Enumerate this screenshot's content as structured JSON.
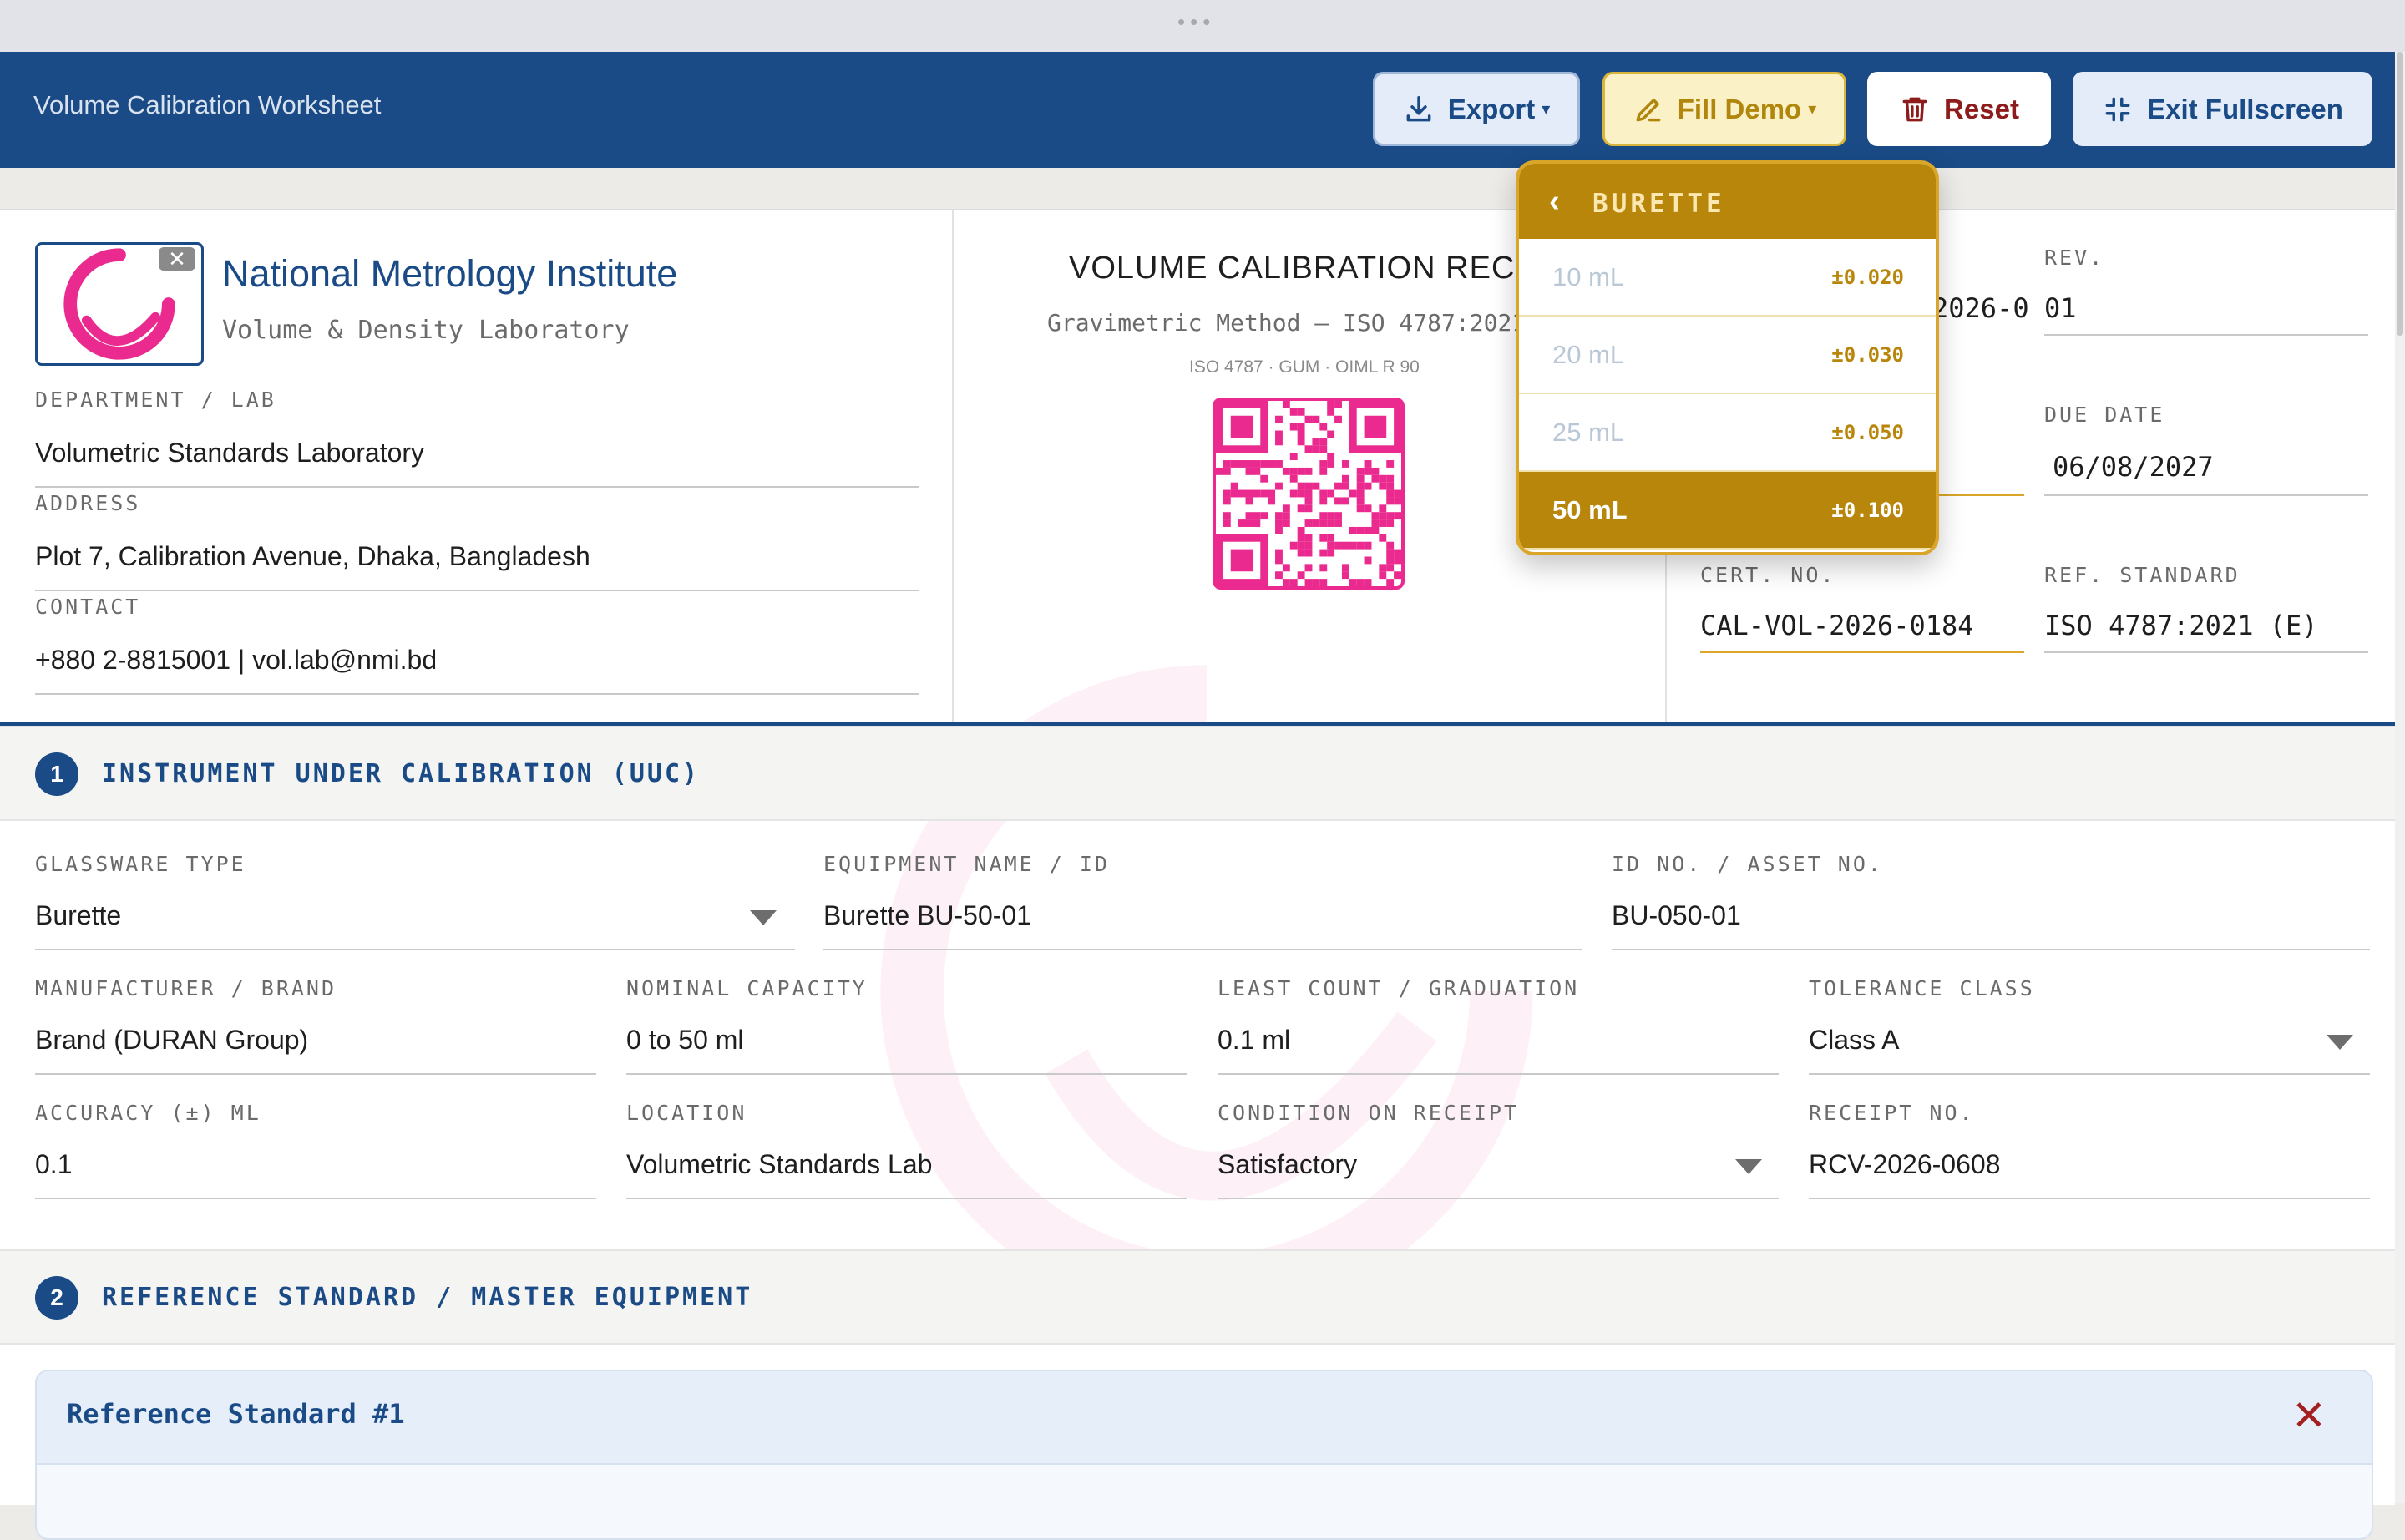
{
  "app": {
    "title": "Volume Calibration Worksheet"
  },
  "toolbar": {
    "export_label": "Export",
    "fill_demo_label": "Fill Demo",
    "reset_label": "Reset",
    "exit_fullscreen_label": "Exit Fullscreen",
    "dropdown_caret": "▾"
  },
  "org": {
    "name": "National Metrology Institute",
    "subtitle": "Volume & Density Laboratory",
    "remove_logo_glyph": "✕",
    "department_label": "DEPARTMENT / LAB",
    "department": "Volumetric Standards Laboratory",
    "address_label": "ADDRESS",
    "address": "Plot 7, Calibration Avenue, Dhaka, Bangladesh",
    "contact_label": "CONTACT",
    "contact": "+880 2-8815001 | vol.lab@nmi.bd"
  },
  "record": {
    "title": "VOLUME CALIBRATION RECORD",
    "subtitle": "Gravimetric Method — ISO 4787:2021",
    "standards": "ISO 4787 · GUM · OIML R 90"
  },
  "meta": {
    "doc_no_partial": "2026-0",
    "rev_label": "REV.",
    "rev": "01",
    "due_date_label": "DUE DATE",
    "due_date": "06/08/2027",
    "cert_no_label": "CERT. NO.",
    "cert_no": "CAL-VOL-2026-0184",
    "ref_standard_label": "REF. STANDARD",
    "ref_standard": "ISO 4787:2021 (E)"
  },
  "section1": {
    "number": "1",
    "title": "INSTRUMENT UNDER CALIBRATION (UUC)",
    "glassware_type_label": "GLASSWARE TYPE",
    "glassware_type": "Burette",
    "equipment_name_label": "EQUIPMENT NAME / ID",
    "equipment_name": "Burette BU-50-01",
    "asset_no_label": "ID NO. / ASSET NO.",
    "asset_no": "BU-050-01",
    "manufacturer_label": "MANUFACTURER / BRAND",
    "manufacturer": "Brand (DURAN Group)",
    "nominal_capacity_label": "NOMINAL CAPACITY",
    "nominal_capacity": "0 to 50 ml",
    "least_count_label": "LEAST COUNT / GRADUATION",
    "least_count": "0.1 ml",
    "tolerance_class_label": "TOLERANCE CLASS",
    "tolerance_class": "Class A",
    "accuracy_label": "ACCURACY (±) ML",
    "accuracy": "0.1",
    "location_label": "LOCATION",
    "location": "Volumetric Standards Lab",
    "condition_label": "CONDITION ON RECEIPT",
    "condition": "Satisfactory",
    "receipt_no_label": "RECEIPT NO.",
    "receipt_no": "RCV-2026-0608"
  },
  "section2": {
    "number": "2",
    "title": "REFERENCE STANDARD / MASTER EQUIPMENT",
    "card_title": "Reference Standard #1",
    "close_glyph": "✕"
  },
  "demo_dropdown": {
    "back_glyph": "‹",
    "title": "BURETTE",
    "items": [
      {
        "name": "10 mL",
        "tol": "±0.020"
      },
      {
        "name": "20 mL",
        "tol": "±0.030"
      },
      {
        "name": "25 mL",
        "tol": "±0.050"
      },
      {
        "name": "50 mL",
        "tol": "±0.100"
      }
    ],
    "selected_index": 3
  },
  "colors": {
    "brand_blue": "#1a4b86",
    "gold": "#b8860b",
    "reset_red": "#8e1c1c",
    "logo_pink": "#ea2a8e"
  }
}
